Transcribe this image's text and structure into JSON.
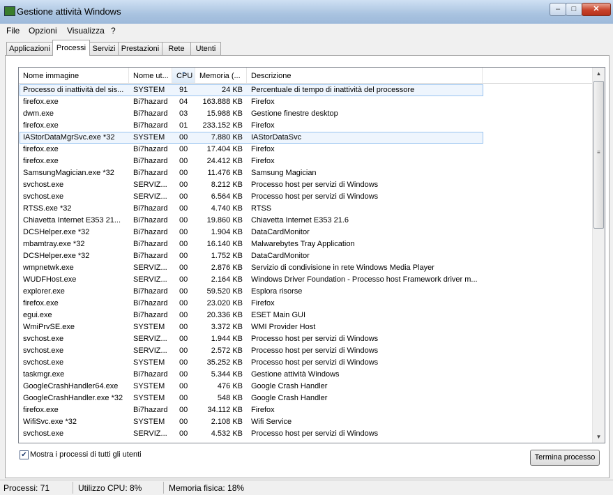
{
  "window": {
    "title": "Gestione attività Windows",
    "min_label": "–",
    "max_label": "□",
    "close_label": "✕"
  },
  "menu": [
    "File",
    "Opzioni",
    "Visualizza",
    "?"
  ],
  "tabs": [
    "Applicazioni",
    "Processi",
    "Servizi",
    "Prestazioni",
    "Rete",
    "Utenti"
  ],
  "active_tab": "Processi",
  "columns": [
    "Nome immagine",
    "Nome ut...",
    "CPU",
    "Memoria (...",
    "Descrizione"
  ],
  "sorted_column": "CPU",
  "rows": [
    [
      "Processo di inattività del sis...",
      "SYSTEM",
      "91",
      "24 KB",
      "Percentuale di tempo di inattività del processore"
    ],
    [
      "firefox.exe",
      "Bi7hazard",
      "04",
      "163.888 KB",
      "Firefox"
    ],
    [
      "dwm.exe",
      "Bi7hazard",
      "03",
      "15.988 KB",
      "Gestione finestre desktop"
    ],
    [
      "firefox.exe",
      "Bi7hazard",
      "01",
      "233.152 KB",
      "Firefox"
    ],
    [
      "IAStorDataMgrSvc.exe *32",
      "SYSTEM",
      "00",
      "7.880 KB",
      "IAStorDataSvc"
    ],
    [
      "firefox.exe",
      "Bi7hazard",
      "00",
      "17.404 KB",
      "Firefox"
    ],
    [
      "firefox.exe",
      "Bi7hazard",
      "00",
      "24.412 KB",
      "Firefox"
    ],
    [
      "SamsungMagician.exe *32",
      "Bi7hazard",
      "00",
      "11.476 KB",
      "Samsung Magician"
    ],
    [
      "svchost.exe",
      "SERVIZ...",
      "00",
      "8.212 KB",
      "Processo host per servizi di Windows"
    ],
    [
      "svchost.exe",
      "SERVIZ...",
      "00",
      "6.564 KB",
      "Processo host per servizi di Windows"
    ],
    [
      "RTSS.exe *32",
      "Bi7hazard",
      "00",
      "4.740 KB",
      "RTSS"
    ],
    [
      "Chiavetta Internet E353 21...",
      "Bi7hazard",
      "00",
      "19.860 KB",
      "Chiavetta Internet E353 21.6"
    ],
    [
      "DCSHelper.exe *32",
      "Bi7hazard",
      "00",
      "1.904 KB",
      "DataCardMonitor"
    ],
    [
      "mbamtray.exe *32",
      "Bi7hazard",
      "00",
      "16.140 KB",
      "Malwarebytes Tray Application"
    ],
    [
      "DCSHelper.exe *32",
      "Bi7hazard",
      "00",
      "1.752 KB",
      "DataCardMonitor"
    ],
    [
      "wmpnetwk.exe",
      "SERVIZ...",
      "00",
      "2.876 KB",
      "Servizio di condivisione in rete Windows Media Player"
    ],
    [
      "WUDFHost.exe",
      "SERVIZ...",
      "00",
      "2.164 KB",
      "Windows Driver Foundation - Processo host Framework driver m..."
    ],
    [
      "explorer.exe",
      "Bi7hazard",
      "00",
      "59.520 KB",
      "Esplora risorse"
    ],
    [
      "firefox.exe",
      "Bi7hazard",
      "00",
      "23.020 KB",
      "Firefox"
    ],
    [
      "egui.exe",
      "Bi7hazard",
      "00",
      "20.336 KB",
      "ESET Main GUI"
    ],
    [
      "WmiPrvSE.exe",
      "SYSTEM",
      "00",
      "3.372 KB",
      "WMI Provider Host"
    ],
    [
      "svchost.exe",
      "SERVIZ...",
      "00",
      "1.944 KB",
      "Processo host per servizi di Windows"
    ],
    [
      "svchost.exe",
      "SERVIZ...",
      "00",
      "2.572 KB",
      "Processo host per servizi di Windows"
    ],
    [
      "svchost.exe",
      "SYSTEM",
      "00",
      "35.252 KB",
      "Processo host per servizi di Windows"
    ],
    [
      "taskmgr.exe",
      "Bi7hazard",
      "00",
      "5.344 KB",
      "Gestione attività Windows"
    ],
    [
      "GoogleCrashHandler64.exe",
      "SYSTEM",
      "00",
      "476 KB",
      "Google Crash Handler"
    ],
    [
      "GoogleCrashHandler.exe *32",
      "SYSTEM",
      "00",
      "548 KB",
      "Google Crash Handler"
    ],
    [
      "firefox.exe",
      "Bi7hazard",
      "00",
      "34.112 KB",
      "Firefox"
    ],
    [
      "WifiSvc.exe *32",
      "SYSTEM",
      "00",
      "2.108 KB",
      "Wifi Service"
    ],
    [
      "svchost.exe",
      "SERVIZ...",
      "00",
      "4.532 KB",
      "Processo host per servizi di Windows"
    ]
  ],
  "selected_rows": [
    0,
    4
  ],
  "show_all_users": {
    "label": "Mostra i processi di tutti gli utenti",
    "checked": true
  },
  "end_process_label": "Termina processo",
  "status": {
    "processes": "Processi: 71",
    "cpu": "Utilizzo CPU: 8%",
    "memory": "Memoria fisica: 18%"
  }
}
